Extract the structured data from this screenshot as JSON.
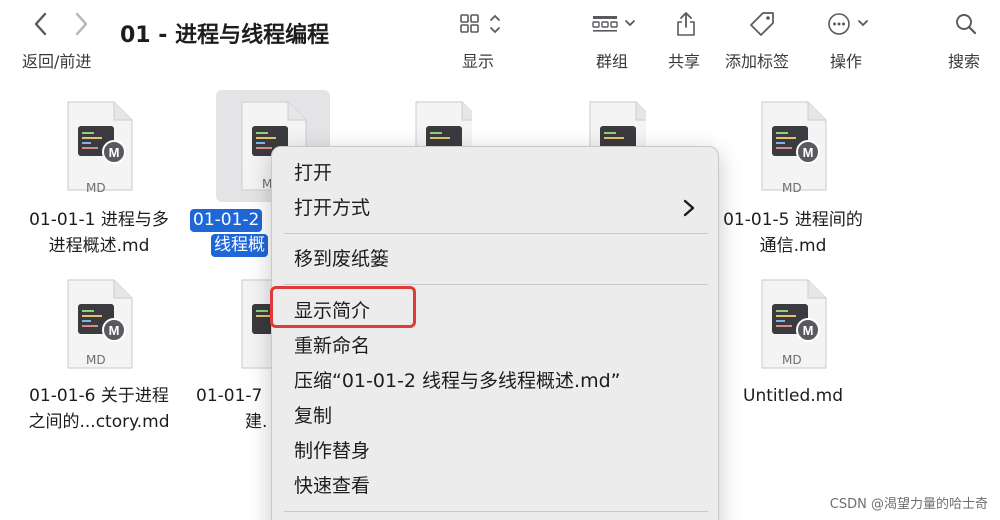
{
  "toolbar": {
    "title": "01 - 进程与线程编程",
    "nav_label": "返回/前进",
    "view_label": "显示",
    "group_label": "群组",
    "share_label": "共享",
    "tags_label": "添加标签",
    "action_label": "操作",
    "search_label": "搜索"
  },
  "files": [
    {
      "line1": "01-01-1 进程与多",
      "line2": "进程概述.md",
      "badge": "MD"
    },
    {
      "line1": "01-01-2",
      "line2": "线程概",
      "badge": "M",
      "selected": true
    },
    {
      "line1": "01-01-5 进程间的",
      "line2": "通信.md",
      "badge": "MD"
    },
    {
      "line1": "01-01-6 关于进程",
      "line2": "之间的...ctory.md",
      "badge": "MD"
    },
    {
      "line1": "01-01-7",
      "line2": "建.",
      "badge": ""
    },
    {
      "line1": "Untitled.md",
      "line2": "",
      "badge": "MD"
    }
  ],
  "menu": {
    "items": [
      "打开",
      "打开方式",
      "移到废纸篓",
      "显示简介",
      "重新命名",
      "压缩“01-01-2 线程与多线程概述.md”",
      "复制",
      "制作替身",
      "快速查看"
    ],
    "highlighted": "显示简介"
  },
  "watermark": "CSDN @渴望力量的哈士奇",
  "colors": {
    "selection": "#1f66d6",
    "highlight_border": "#e03a3a",
    "menu_bg": "#ececec"
  }
}
